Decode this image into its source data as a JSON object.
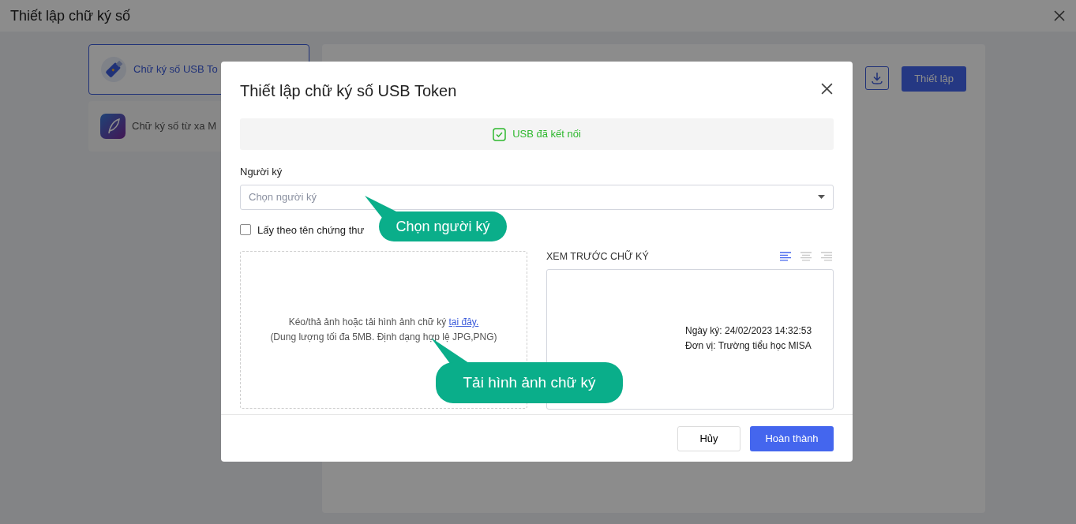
{
  "window": {
    "title": "Thiết lập chữ ký số"
  },
  "methods": [
    {
      "label": "Chữ ký số USB To",
      "selected": true,
      "kind": "usb"
    },
    {
      "label": "Chữ ký số từ xa M",
      "selected": false,
      "kind": "remote"
    }
  ],
  "toolbar": {
    "button": "Thiết lập"
  },
  "dialog": {
    "title": "Thiết lập chữ ký số USB Token",
    "status": "USB đã kết nối",
    "signer": {
      "label": "Người ký",
      "placeholder": "Chọn người ký"
    },
    "use_cert_name": {
      "label": "Lấy theo tên chứng thư",
      "checked": false
    },
    "upload": {
      "text": "Kéo/thả ảnh hoặc tải hình ảnh chữ ký ",
      "link": "tại đây.",
      "note": "(Dung lượng tối đa 5MB. Định dạng hợp lệ JPG,PNG)"
    },
    "preview": {
      "title": "XEM TRƯỚC CHỮ KÝ",
      "alignments": [
        {
          "kind": "left",
          "selected": true
        },
        {
          "kind": "center",
          "selected": false
        },
        {
          "kind": "right",
          "selected": false
        }
      ],
      "lines": [
        "Ngày ký: 24/02/2023 14:32:53",
        "Đơn vị: Trường tiểu học MISA"
      ]
    },
    "buttons": [
      {
        "label": "Hủy",
        "kind": "secondary"
      },
      {
        "label": "Hoàn thành",
        "kind": "primary"
      }
    ]
  },
  "callouts": [
    {
      "text": "Chọn người ký"
    },
    {
      "text": "Tải hình ảnh chữ ký"
    }
  ]
}
